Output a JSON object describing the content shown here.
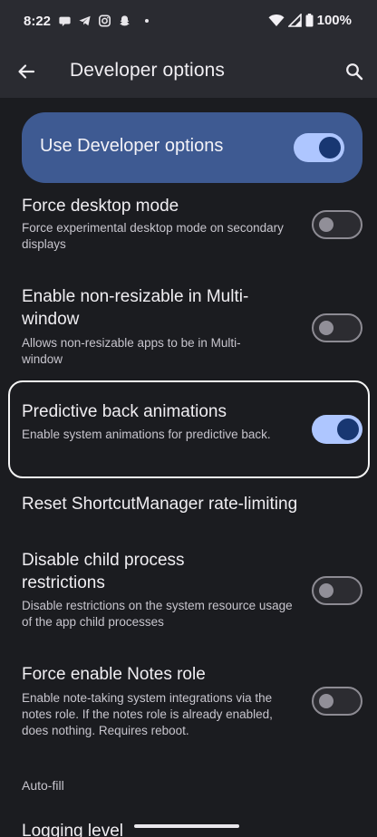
{
  "status_bar": {
    "time": "8:22",
    "battery": "100%",
    "left_icons": [
      "chat-bubble-icon",
      "telegram-icon",
      "instagram-icon",
      "snapchat-icon",
      "notification-dot-icon"
    ],
    "right_icons": [
      "wifi-icon",
      "cell-signal-icon",
      "battery-icon"
    ]
  },
  "app_bar": {
    "title": "Developer options",
    "back_icon": "arrow-back-icon",
    "search_icon": "search-icon"
  },
  "master": {
    "label": "Use Developer options",
    "on": true
  },
  "settings": [
    {
      "title": "Force desktop mode",
      "summary": "Force experimental desktop mode on secondary displays",
      "toggle": "off"
    },
    {
      "title": "Enable non-resizable in Multi-window",
      "summary": "Allows non-resizable apps to be in Multi-window",
      "toggle": "off"
    },
    {
      "title": "Predictive back animations",
      "summary": "Enable system animations for predictive back.",
      "toggle": "on"
    },
    {
      "title": "Reset ShortcutManager rate-limiting",
      "summary": "",
      "toggle": "none"
    },
    {
      "title": "Disable child process restrictions",
      "summary": "Disable restrictions on the system resource usage of the app child processes",
      "toggle": "off"
    },
    {
      "title": "Force enable Notes role",
      "summary": "Enable note-taking system integrations via the notes role. If the notes role is already enabled, does nothing. Requires reboot.",
      "toggle": "off"
    }
  ],
  "section_header": "Auto-fill",
  "next_item": "Logging level",
  "colors": {
    "background": "#1b1c20",
    "app_bar": "#2a2b31",
    "master_card": "#3e5a92",
    "toggle_on_track": "#aec6ff",
    "toggle_on_knob": "#183772",
    "toggle_off_outline": "#8d8b93"
  }
}
